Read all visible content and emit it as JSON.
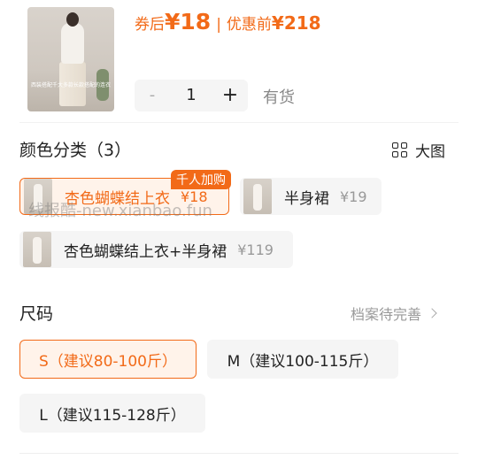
{
  "product": {
    "thumb_caption": "西装搭配千大多款长款搭配的连衣裙",
    "price_coupon_label": "券后",
    "price_coupon_value": "¥18",
    "price_original_label": "优惠前",
    "price_original_value": "¥218",
    "separator": "|"
  },
  "quantity": {
    "minus": "-",
    "value": "1",
    "plus": "+",
    "stock_status": "有货"
  },
  "color_section": {
    "title": "颜色分类（3）",
    "big_picture_label": "大图",
    "badge": "千人加购",
    "options": [
      {
        "name": "杏色蝴蝶结上衣",
        "price": "¥18",
        "selected": true
      },
      {
        "name": "半身裙",
        "price": "¥19",
        "selected": false
      },
      {
        "name": "杏色蝴蝶结上衣+半身裙",
        "price": "¥119",
        "selected": false
      }
    ]
  },
  "size_section": {
    "title": "尺码",
    "archive_link": "档案待完善",
    "options": [
      {
        "label": "S（建议80-100斤）",
        "selected": true
      },
      {
        "label": "M（建议100-115斤）",
        "selected": false
      },
      {
        "label": "L（建议115-128斤）",
        "selected": false
      }
    ]
  },
  "watermark": "线报酷-new.xianbao.fun",
  "colors": {
    "accent": "#f26a18",
    "chip_bg": "#f5f5f5",
    "muted_text": "#999999"
  }
}
